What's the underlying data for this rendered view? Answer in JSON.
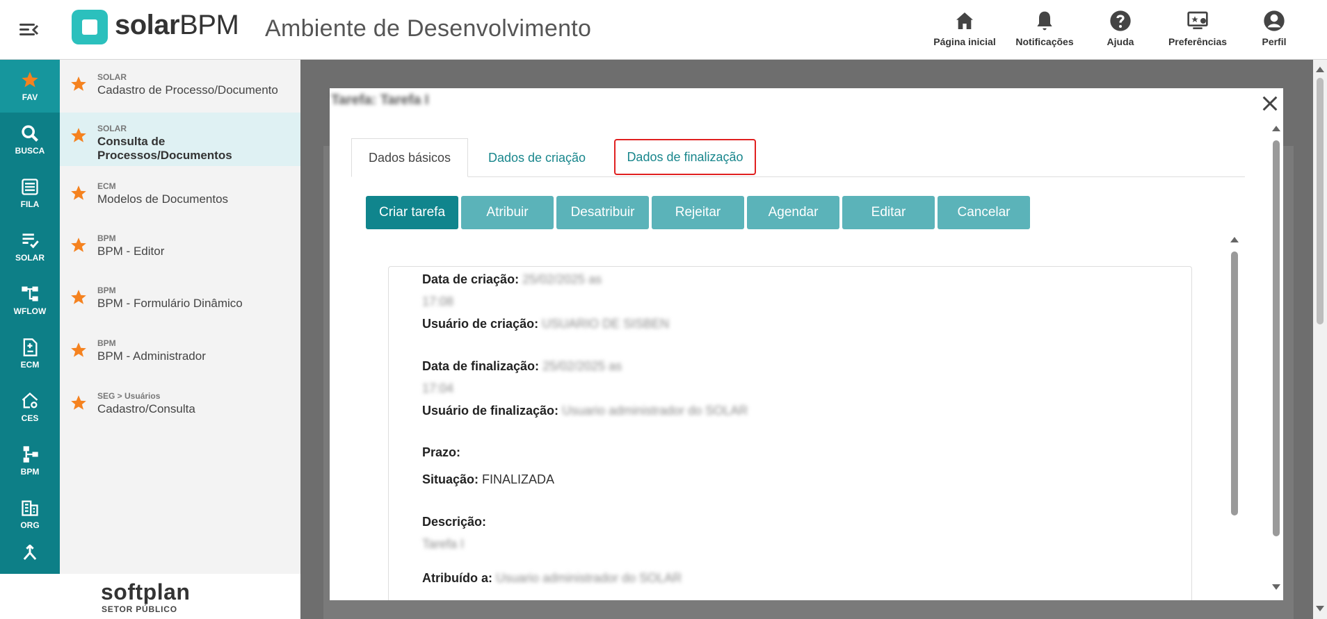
{
  "header": {
    "logo_bold": "solar",
    "logo_regular": "BPM",
    "env_title": "Ambiente de Desenvolvimento",
    "nav": [
      {
        "label": "Página inicial",
        "icon": "home-icon"
      },
      {
        "label": "Notificações",
        "icon": "bell-icon"
      },
      {
        "label": "Ajuda",
        "icon": "help-icon"
      },
      {
        "label": "Preferências",
        "icon": "preferences-icon"
      },
      {
        "label": "Perfil",
        "icon": "profile-icon"
      }
    ]
  },
  "rail": {
    "items": [
      {
        "label": "FAV",
        "icon": "star-icon"
      },
      {
        "label": "BUSCA",
        "icon": "search-icon"
      },
      {
        "label": "FILA",
        "icon": "list-icon"
      },
      {
        "label": "SOLAR",
        "icon": "checklist-icon"
      },
      {
        "label": "WFLOW",
        "icon": "workflow-icon"
      },
      {
        "label": "ECM",
        "icon": "document-icon"
      },
      {
        "label": "CES",
        "icon": "home-gear-icon"
      },
      {
        "label": "BPM",
        "icon": "process-icon"
      },
      {
        "label": "ORG",
        "icon": "building-icon"
      }
    ]
  },
  "favorites": [
    {
      "category": "SOLAR",
      "name": "Cadastro de Processo/Documento"
    },
    {
      "category": "SOLAR",
      "name": "Consulta de Processos/Documentos"
    },
    {
      "category": "ECM",
      "name": "Modelos de Documentos"
    },
    {
      "category": "BPM",
      "name": "BPM - Editor"
    },
    {
      "category": "BPM",
      "name": "BPM - Formulário Dinâmico"
    },
    {
      "category": "BPM",
      "name": "BPM - Administrador"
    },
    {
      "category": "SEG > Usuários",
      "name": "Cadastro/Consulta"
    }
  ],
  "footer": {
    "brand": "softplan",
    "sub": "SETOR PÚBLICO"
  },
  "modal": {
    "title": "Tarefa: Tarefa I",
    "tabs": [
      "Dados básicos",
      "Dados de criação",
      "Dados de finalização"
    ],
    "buttons": [
      "Criar tarefa",
      "Atribuir",
      "Desatribuir",
      "Rejeitar",
      "Agendar",
      "Editar",
      "Cancelar"
    ],
    "fields": {
      "created_date_label": "Data de criação:",
      "created_date_value": "25/02/2025 as",
      "created_time_value": "17:08",
      "created_user_label": "Usuário de criação:",
      "created_user_value": "USUARIO DE SISBEN",
      "finish_date_label": "Data de finalização:",
      "finish_date_value": "25/02/2025 as",
      "finish_time_value": "17:04",
      "finish_user_label": "Usuário de finalização:",
      "finish_user_value": "Usuario administrador do SOLAR",
      "deadline_label": "Prazo:",
      "status_label": "Situação:",
      "status_value": "FINALIZADA",
      "description_label": "Descrição:",
      "description_value": "Tarefa I",
      "assigned_label": "Atribuído a:",
      "assigned_value": "Usuario administrador do SOLAR"
    }
  }
}
